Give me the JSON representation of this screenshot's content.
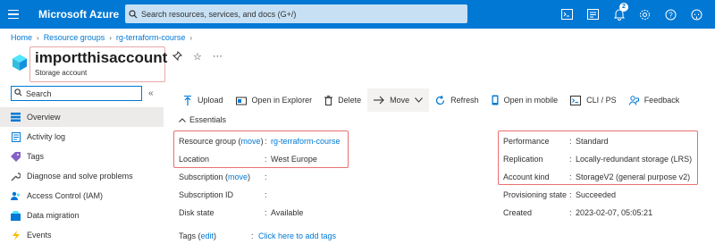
{
  "topbar": {
    "brand": "Microsoft Azure",
    "search_placeholder": "Search resources, services, and docs (G+/)",
    "notification_count": "2"
  },
  "breadcrumb": [
    "Home",
    "Resource groups",
    "rg-terraform-course"
  ],
  "resource": {
    "name": "importthisaccount",
    "type": "Storage account"
  },
  "sidebar": {
    "search_placeholder": "Search",
    "items": [
      {
        "label": "Overview",
        "icon": "overview-icon"
      },
      {
        "label": "Activity log",
        "icon": "activity-log-icon"
      },
      {
        "label": "Tags",
        "icon": "tag-icon"
      },
      {
        "label": "Diagnose and solve problems",
        "icon": "wrench-icon"
      },
      {
        "label": "Access Control (IAM)",
        "icon": "people-icon"
      },
      {
        "label": "Data migration",
        "icon": "data-migration-icon"
      },
      {
        "label": "Events",
        "icon": "lightning-icon"
      }
    ]
  },
  "toolbar": {
    "upload": "Upload",
    "open_explorer": "Open in Explorer",
    "delete": "Delete",
    "move": "Move",
    "refresh": "Refresh",
    "open_mobile": "Open in mobile",
    "cli": "CLI / PS",
    "feedback": "Feedback"
  },
  "essentials_label": "Essentials",
  "left_props": {
    "resource_group_label": "Resource group",
    "move_link": "move",
    "resource_group_value": "rg-terraform-course",
    "location_label": "Location",
    "location_value": "West Europe",
    "subscription_label": "Subscription",
    "subscription_value": "",
    "subscription_id_label": "Subscription ID",
    "subscription_id_value": "",
    "disk_state_label": "Disk state",
    "disk_state_value": "Available",
    "tags_label": "Tags",
    "edit_link": "edit",
    "tags_value": "Click here to add tags"
  },
  "right_props": {
    "performance_label": "Performance",
    "performance_value": "Standard",
    "replication_label": "Replication",
    "replication_value": "Locally-redundant storage (LRS)",
    "account_kind_label": "Account kind",
    "account_kind_value": "StorageV2 (general purpose v2)",
    "provisioning_label": "Provisioning state",
    "provisioning_value": "Succeeded",
    "created_label": "Created",
    "created_value": "2023-02-07, 05:05:21"
  },
  "colors": {
    "accent": "#0078d4",
    "highlight": "#e87070"
  }
}
